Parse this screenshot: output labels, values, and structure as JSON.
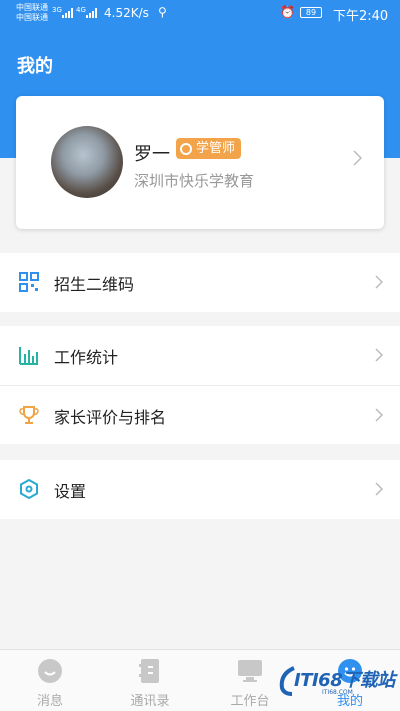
{
  "status_bar": {
    "carrier1": "中国联通",
    "carrier2": "中国联通",
    "net1": "3G",
    "net2": "4G",
    "speed": "4.52K/s",
    "battery": "89",
    "time": "下午2:40"
  },
  "header": {
    "title": "我的"
  },
  "profile": {
    "name": "罗一",
    "role": "学管师",
    "organization": "深圳市快乐学教育"
  },
  "menu": {
    "qr_code": "招生二维码",
    "work_stats": "工作统计",
    "parent_rating": "家长评价与排名",
    "settings": "设置"
  },
  "tabs": [
    {
      "label": "消息",
      "icon": "message-icon"
    },
    {
      "label": "通讯录",
      "icon": "contacts-icon"
    },
    {
      "label": "工作台",
      "icon": "workbench-icon"
    },
    {
      "label": "我的",
      "icon": "me-icon"
    }
  ],
  "watermark": {
    "text": "ITI68下载站",
    "sub": "ITI68.COM"
  },
  "colors": {
    "accent": "#2f90f0",
    "badge": "#f3a44a",
    "stats": "#27b3a3",
    "trophy": "#f0a444"
  }
}
